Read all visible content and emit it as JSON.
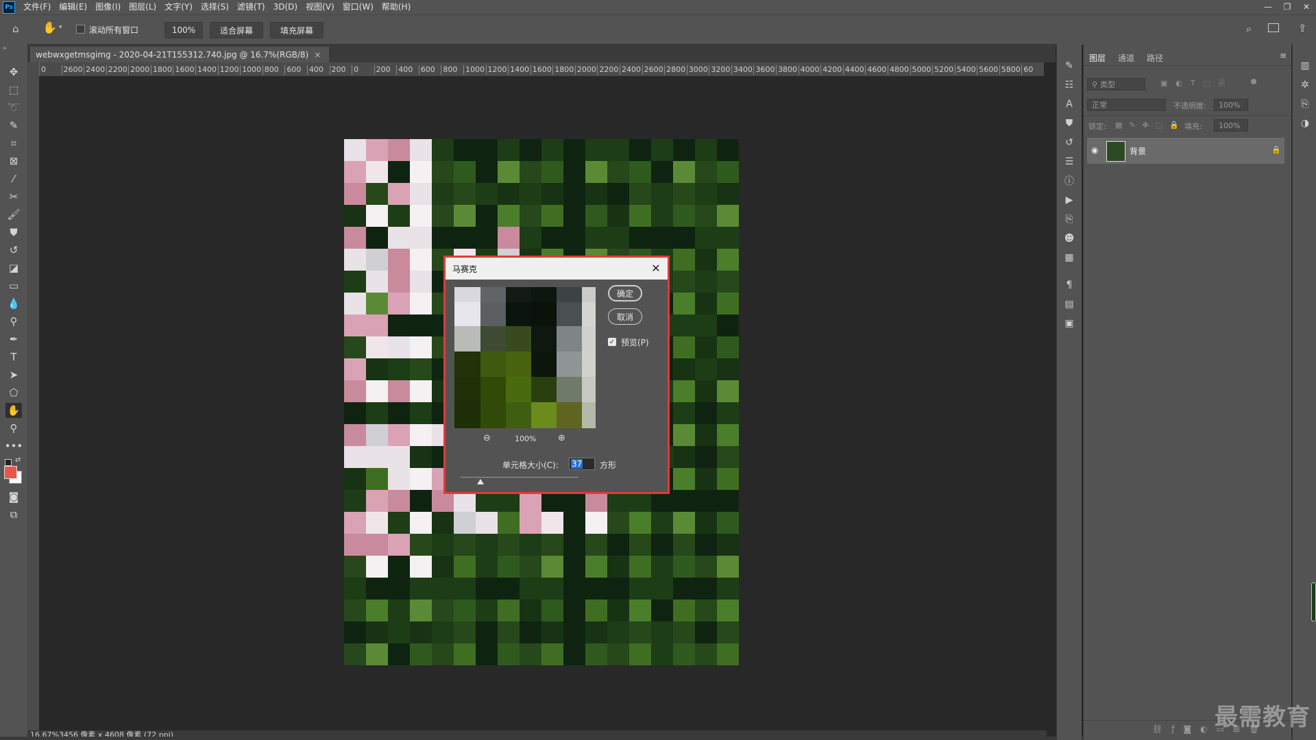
{
  "app": {
    "logo_text": "Ps",
    "menus": [
      "文件(F)",
      "编辑(E)",
      "图像(I)",
      "图层(L)",
      "文字(Y)",
      "选择(S)",
      "滤镜(T)",
      "3D(D)",
      "视图(V)",
      "窗口(W)",
      "帮助(H)"
    ],
    "window_controls": [
      "—",
      "❐",
      "✕"
    ]
  },
  "options": {
    "scroll_all_label": "滚动所有窗口",
    "zoom_value": "100%",
    "fit_screen_label": "适合屏幕",
    "fill_screen_label": "填充屏幕"
  },
  "document": {
    "tab_title": "webwxgetmsgimg - 2020-04-21T155312.740.jpg @ 16.7%(RGB/8)",
    "tab_close": "×"
  },
  "ruler": {
    "ticks": [
      "0",
      "2600",
      "2400",
      "2200",
      "2000",
      "1800",
      "1600",
      "1400",
      "1200",
      "1000",
      "800",
      "600",
      "400",
      "200",
      "0",
      "200",
      "400",
      "600",
      "800",
      "1000",
      "1200",
      "1400",
      "1600",
      "1800",
      "2000",
      "2200",
      "2400",
      "2600",
      "2800",
      "3000",
      "3200",
      "3400",
      "3600",
      "3800",
      "4000",
      "4200",
      "4400",
      "4600",
      "4800",
      "5000",
      "5200",
      "5400",
      "5600",
      "5800",
      "60"
    ]
  },
  "status": {
    "text": "16.67%3456 像素 x 4608 像素 (72 ppi)"
  },
  "layers_panel": {
    "tabs": [
      "图层",
      "通道",
      "路径"
    ],
    "filter_placeholder": "类型",
    "blend_mode": "正常",
    "opacity_label": "不透明度:",
    "opacity_value": "100%",
    "lock_label": "锁定:",
    "fill_label": "填充:",
    "fill_value": "100%",
    "layer_name": "背景"
  },
  "dialog": {
    "title": "马赛克",
    "ok_label": "确定",
    "cancel_label": "取消",
    "preview_label": "预览(P)",
    "zoom_value": "100%",
    "cell_size_label": "单元格大小(C):",
    "cell_size_value": "37",
    "cell_unit": "方形",
    "preview_colors": [
      [
        "#d8d8de",
        "#5f6466",
        "#141a14",
        "#0e1610",
        "#3c4342",
        "#c9ccc8"
      ],
      [
        "#e6e6ec",
        "#5a5f5f",
        "#0b140c",
        "#0a120a",
        "#4a5050",
        "#d3d5d0"
      ],
      [
        "#b8bbb8",
        "#3f4a32",
        "#384a1e",
        "#0e1810",
        "#7e8584",
        "#cfd1cc"
      ],
      [
        "#233208",
        "#3f5a0c",
        "#48630f",
        "#0c160c",
        "#8f9594",
        "#d0d2cc"
      ],
      [
        "#1f3006",
        "#2f4b07",
        "#4a6a0e",
        "#2a3f0e",
        "#707a6a",
        "#c8cac2"
      ],
      [
        "#1e2e06",
        "#304a09",
        "#3f5e10",
        "#6b8b1a",
        "#5f6520",
        "#b5b9a8"
      ]
    ]
  },
  "watermark": "最需教育",
  "colors": {
    "foreground": "#e8574b",
    "background": "#ffffff",
    "dialog_border": "#e53935"
  }
}
